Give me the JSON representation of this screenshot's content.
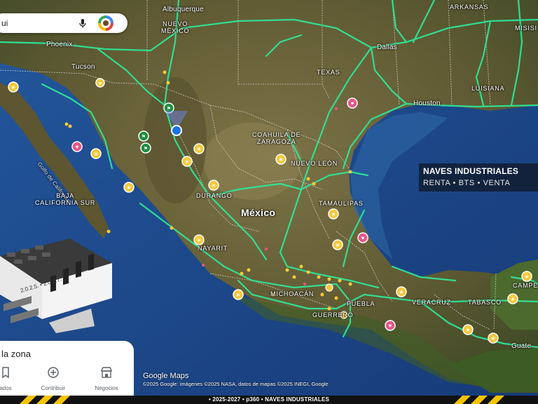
{
  "map": {
    "labels": {
      "albuquerque": "Albuquerque",
      "nuevo_mexico": "NUEVO\nMÉXICO",
      "arkansas": "ARKANSAS",
      "misisipi": "MISISI",
      "phoenix": "Phoenix",
      "dallas": "Dallas",
      "tucson": "Tucson",
      "texas": "TEXAS",
      "luisiana": "LUISIANA",
      "houston": "Houston",
      "coahuila": "COAHUILA DE\nZARAGOZA",
      "golfo_california": "Golfo de California",
      "nuevo_leon": "NUEVO LEÓN",
      "baja_california_sur": "BAJA\nCALIFORNIA SUR",
      "durango": "DURANGO",
      "tamaulipas": "TAMAULIPAS",
      "mexico": "México",
      "nayarit": "NAYARIT",
      "campeche": "CAMPE",
      "michoacan": "MICHOACÁN",
      "puebla": "PUEBLA",
      "veracruz": "VERACRUZ",
      "tabasco": "TABASCO",
      "guerrero": "GUERRERO",
      "guatemala": "Guate"
    },
    "colors": {
      "ocean": "#1d4a8c",
      "land": "#6b6238",
      "roads": "#2ee89a",
      "borders": "#e8e8e8",
      "star_marker": "#f6c93a",
      "heart_marker": "#e8558a",
      "flag_marker": "#1e8e3e",
      "location_dot": "#1a73e8"
    }
  },
  "search": {
    "value": "ui"
  },
  "banner": {
    "title": "NAVES INDUSTRIALES",
    "subtitle": "RENTA  •  BTS  •  VENTA"
  },
  "illustration": {
    "years": "2.0.2.5. • 2.0.2.7."
  },
  "sheet": {
    "title": "la zona",
    "nav": [
      {
        "label": "ados",
        "icon": "bookmark-icon"
      },
      {
        "label": "Contribuir",
        "icon": "add-circle-icon"
      },
      {
        "label": "Negocios",
        "icon": "storefront-icon"
      }
    ]
  },
  "attribution": {
    "logo": "Google Maps",
    "copyright": "©2025 Google: imágenes ©2025 NASA, datos de mapas ©2025 INEGI, Google"
  },
  "footer": {
    "text": "• 2025-2027 • p360 • NAVES INDUSTRIALES"
  }
}
